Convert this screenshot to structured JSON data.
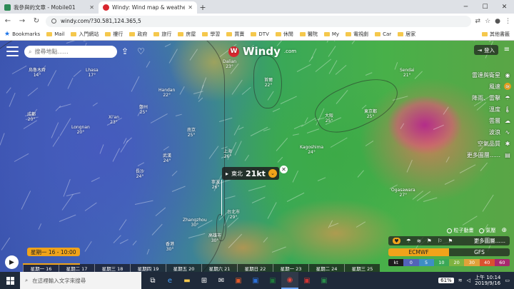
{
  "browser": {
    "tabs": [
      {
        "title": "我參與的文章 - Mobile01",
        "color": "#2e8b57",
        "active": false
      },
      {
        "title": "Windy: Wind map & weather fo",
        "color": "#d8262f",
        "active": true
      }
    ],
    "url": "windy.com/?30.581,124.365,5",
    "bookmarks_label": "Bookmarks",
    "bookmarks": [
      "Mail",
      "入門網站",
      "樓行",
      "政府",
      "旅行",
      "房屋",
      "學習",
      "買賣",
      "DTV",
      "休閒",
      "醫院",
      "My",
      "電視劇",
      "Car",
      "居家"
    ],
    "other_bookmarks": "其他書籤"
  },
  "map": {
    "search_placeholder": "搜尋地點......",
    "logo_text": "Windy",
    "logo_suffix": ".com",
    "login_label": "登入",
    "cities": [
      {
        "name": "烏魯木齊",
        "temp": "14°"
      },
      {
        "name": "Lhasa",
        "temp": "17°"
      },
      {
        "name": "Handan",
        "temp": "22°"
      },
      {
        "name": "鄭州",
        "temp": "25°"
      },
      {
        "name": "成都",
        "temp": "20°"
      },
      {
        "name": "Xi'an",
        "temp": "23°"
      },
      {
        "name": "Longnan",
        "temp": "20°"
      },
      {
        "name": "武漢",
        "temp": "24°"
      },
      {
        "name": "南京",
        "temp": "25°"
      },
      {
        "name": "上海",
        "temp": "26°"
      },
      {
        "name": "寧波",
        "temp": "26°"
      },
      {
        "name": "長沙",
        "temp": "24°"
      },
      {
        "name": "Zhangzhou",
        "temp": "30°"
      },
      {
        "name": "台北市",
        "temp": "29°"
      },
      {
        "name": "高雄市",
        "temp": "30°"
      },
      {
        "name": "香港",
        "temp": "30°"
      },
      {
        "name": "首爾",
        "temp": "22°"
      },
      {
        "name": "大阪",
        "temp": "25°"
      },
      {
        "name": "Kagoshima",
        "temp": "24°"
      },
      {
        "name": "東京都",
        "temp": "25°"
      },
      {
        "name": "Sendai",
        "temp": "21°"
      },
      {
        "name": "Dalian",
        "temp": "23°"
      },
      {
        "name": "Ogasawara",
        "temp": "27°"
      }
    ],
    "popup": {
      "direction": "東北",
      "speed": "21kt"
    },
    "layers": [
      {
        "label": "雷達與衛星",
        "icon": "satellite-icon",
        "glyph": "◉",
        "selected": false
      },
      {
        "label": "風速",
        "icon": "wind-icon",
        "glyph": "≋",
        "selected": true
      },
      {
        "label": "降雨、雷擊",
        "icon": "rain-icon",
        "glyph": "☂",
        "selected": false
      },
      {
        "label": "溫度",
        "icon": "thermometer-icon",
        "glyph": "🌡",
        "selected": false
      },
      {
        "label": "雲層",
        "icon": "cloud-icon",
        "glyph": "☁",
        "selected": false
      },
      {
        "label": "波浪",
        "icon": "wave-icon",
        "glyph": "∿",
        "selected": false
      },
      {
        "label": "空氣品質",
        "icon": "air-quality-icon",
        "glyph": "✱",
        "selected": false
      },
      {
        "label": "更多圖層......",
        "icon": "more-layers-icon",
        "glyph": "▤",
        "selected": false
      }
    ],
    "options": {
      "particles": "粒子動畫",
      "pressure": "氣壓"
    },
    "more_layers_label": "更多圖層......",
    "models": {
      "primary": "ECMWF",
      "secondary": "GFS"
    },
    "legend": {
      "unit": "kt",
      "values": [
        "0",
        "5",
        "10",
        "20",
        "30",
        "40",
        "60"
      ],
      "colors": [
        "#5264b8",
        "#3e8ec4",
        "#3aa857",
        "#7fb340",
        "#e0a23a",
        "#d9512f",
        "#a8286d"
      ]
    }
  },
  "timeline": {
    "current": "星期一 16 - 10:00",
    "days": [
      "星期一 16",
      "星期二 17",
      "星期三 18",
      "星期四 19",
      "星期五 20",
      "星期六 21",
      "星期日 22",
      "星期一 23",
      "星期二 24",
      "星期三 25"
    ]
  },
  "taskbar": {
    "search_placeholder": "在這裡輸入文字來搜尋",
    "battery": "61%",
    "time": "上午 10:14",
    "date": "2019/9/16"
  }
}
